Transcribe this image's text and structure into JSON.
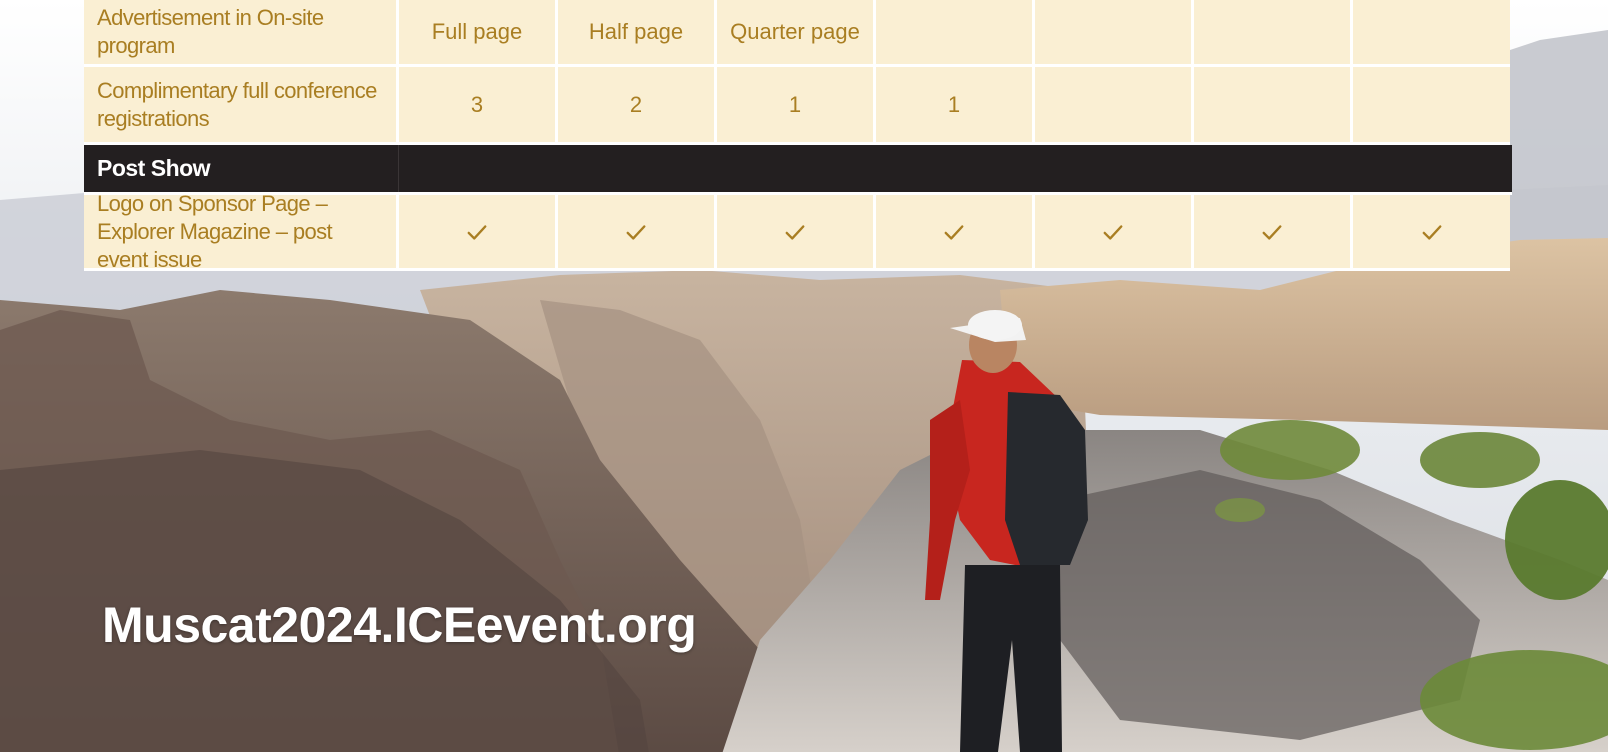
{
  "table": {
    "rows": [
      {
        "label": "Advertisement in On-site program",
        "values": [
          "Full page",
          "Half page",
          "Quarter page",
          "",
          "",
          "",
          ""
        ]
      },
      {
        "label": "Complimentary full conference registrations",
        "values": [
          "3",
          "2",
          "1",
          "1",
          "",
          "",
          ""
        ]
      }
    ],
    "section": {
      "label": "Post Show"
    },
    "post_rows": [
      {
        "label": "Logo on Sponsor Page – Explorer Magazine – post event issue",
        "checks": [
          true,
          true,
          true,
          true,
          true,
          true,
          true
        ]
      }
    ]
  },
  "footer": {
    "url": "Muscat2024.ICEevent.org"
  },
  "colors": {
    "cell_bg": "#faefd3",
    "cell_text": "#a97e22",
    "section_bg": "#231f20"
  },
  "icons": {
    "check": "check-icon"
  }
}
